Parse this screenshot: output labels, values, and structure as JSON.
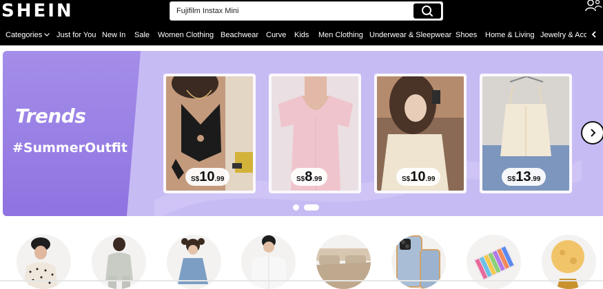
{
  "header": {
    "logo": "SHEIN",
    "search_value": "Fujifilm Instax Mini",
    "search_icon": "magnifier-icon",
    "user_icon": "user-icon"
  },
  "nav": {
    "items": [
      {
        "label": "Categories",
        "has_dropdown": true
      },
      {
        "label": "Just for You"
      },
      {
        "label": "New In"
      },
      {
        "label": "Sale"
      },
      {
        "label": "Women Clothing"
      },
      {
        "label": "Beachwear"
      },
      {
        "label": "Curve"
      },
      {
        "label": "Kids"
      },
      {
        "label": "Men Clothing"
      },
      {
        "label": "Underwear & Sleepwear"
      },
      {
        "label": "Shoes"
      },
      {
        "label": "Home & Living"
      },
      {
        "label": "Jewelry & Acce"
      }
    ],
    "scroll_icon": "chevron-left-icon"
  },
  "banner": {
    "title": "Trends",
    "hashtag": "#SummerOutfit",
    "next_icon": "chevron-right-icon",
    "active_slide": 2,
    "slide_count": 2,
    "products": [
      {
        "currency": "S$",
        "price_int": "10",
        "price_dec": ".99",
        "image": "black halter crop top"
      },
      {
        "currency": "S$",
        "price_int": "8",
        "price_dec": ".99",
        "image": "pink short-sleeve knit top"
      },
      {
        "currency": "S$",
        "price_int": "10",
        "price_dec": ".99",
        "image": "cream lace short-sleeve top"
      },
      {
        "currency": "S$",
        "price_int": "13",
        "price_dec": ".99",
        "image": "cream lace camisole top"
      }
    ]
  },
  "categories": [
    {
      "name": "women-clothing",
      "image": "woman in polka dot top and beanie"
    },
    {
      "name": "curve",
      "image": "plus size woman in grey loungewear"
    },
    {
      "name": "kids",
      "image": "girl in blue denim dress"
    },
    {
      "name": "men-clothing",
      "image": "man in white shirt"
    },
    {
      "name": "home-living",
      "image": "beige bedding set"
    },
    {
      "name": "cell-phone-accessories",
      "image": "quilted phone case"
    },
    {
      "name": "office-school-supplies",
      "image": "marker pen set"
    },
    {
      "name": "lighting",
      "image": "moon lamp"
    }
  ],
  "colors": {
    "header_bg": "#000000",
    "banner_bg": "#c7bbf4",
    "banner_panel": "#9a82e6",
    "price_pill": "#ffffff"
  }
}
